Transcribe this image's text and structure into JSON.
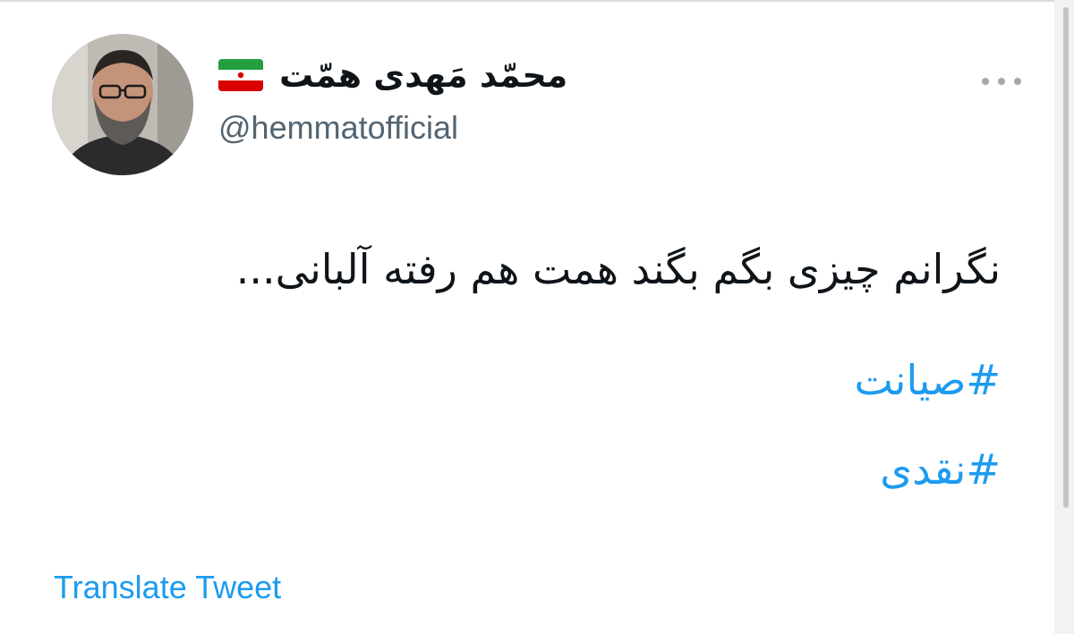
{
  "tweet": {
    "author": {
      "display_name": "محمّد مَهدی همّت",
      "handle": "@hemmatofficial",
      "flag": "iran-flag"
    },
    "text": "نگرانم چیزی بگم بگند همت هم رفته آلبانی...",
    "hashtags": [
      "#صیانت",
      "#نقدی"
    ],
    "translate_label": "Translate Tweet"
  },
  "colors": {
    "link": "#1d9bf0",
    "handle": "#536471",
    "text": "#0f1419"
  },
  "icons": {
    "more": "more-horizontal-icon"
  }
}
